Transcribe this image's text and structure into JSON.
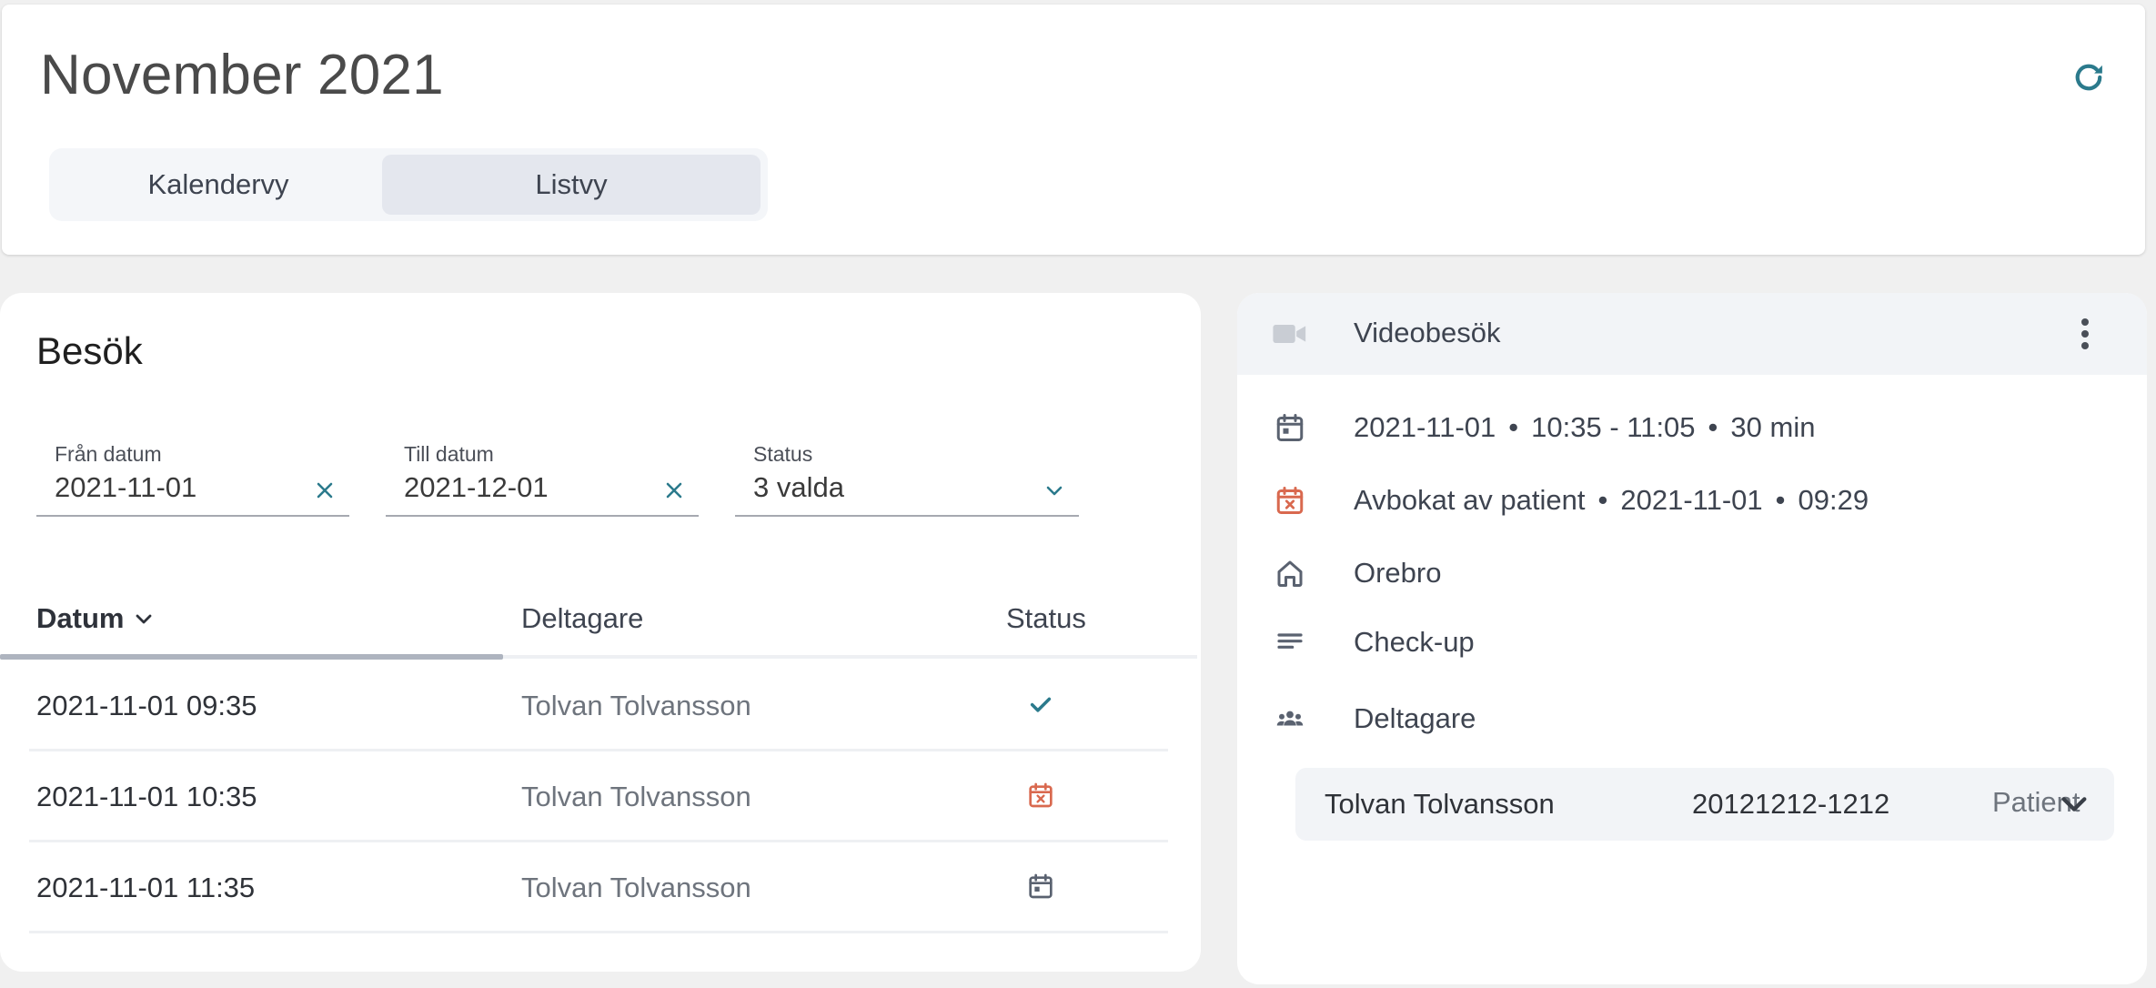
{
  "header": {
    "title": "November 2021",
    "refresh_icon": "refresh-icon",
    "views": {
      "calendar_label": "Kalendervy",
      "list_label": "Listvy",
      "selected": "Listvy"
    }
  },
  "visits": {
    "title": "Besök",
    "filters": {
      "from": {
        "label": "Från datum",
        "value": "2021-11-01"
      },
      "to": {
        "label": "Till datum",
        "value": "2021-12-01"
      },
      "status": {
        "label": "Status",
        "value": "3 valda"
      }
    },
    "columns": {
      "date": "Datum",
      "participants": "Deltagare",
      "status": "Status"
    },
    "rows": [
      {
        "date": "2021-11-01 09:35",
        "participant": "Tolvan Tolvansson",
        "status_icon": "check-icon"
      },
      {
        "date": "2021-11-01 10:35",
        "participant": "Tolvan Tolvansson",
        "status_icon": "calendar-cancelled-icon"
      },
      {
        "date": "2021-11-01 11:35",
        "participant": "Tolvan Tolvansson",
        "status_icon": "calendar-icon"
      }
    ]
  },
  "detail": {
    "type": "Videobesök",
    "date": "2021-11-01",
    "time": "10:35 - 11:05",
    "duration": "30 min",
    "cancel_text": "Avbokat av patient",
    "cancel_date": "2021-11-01",
    "cancel_time": "09:29",
    "location": "Orebro",
    "reason": "Check-up",
    "participants_label": "Deltagare",
    "participant": {
      "name": "Tolvan Tolvansson",
      "id": "20121212-1212",
      "role": "Patient"
    }
  },
  "colors": {
    "accent": "#2b7a8c",
    "cancelled": "#d9694f",
    "neutral_icon": "#5a6270"
  }
}
